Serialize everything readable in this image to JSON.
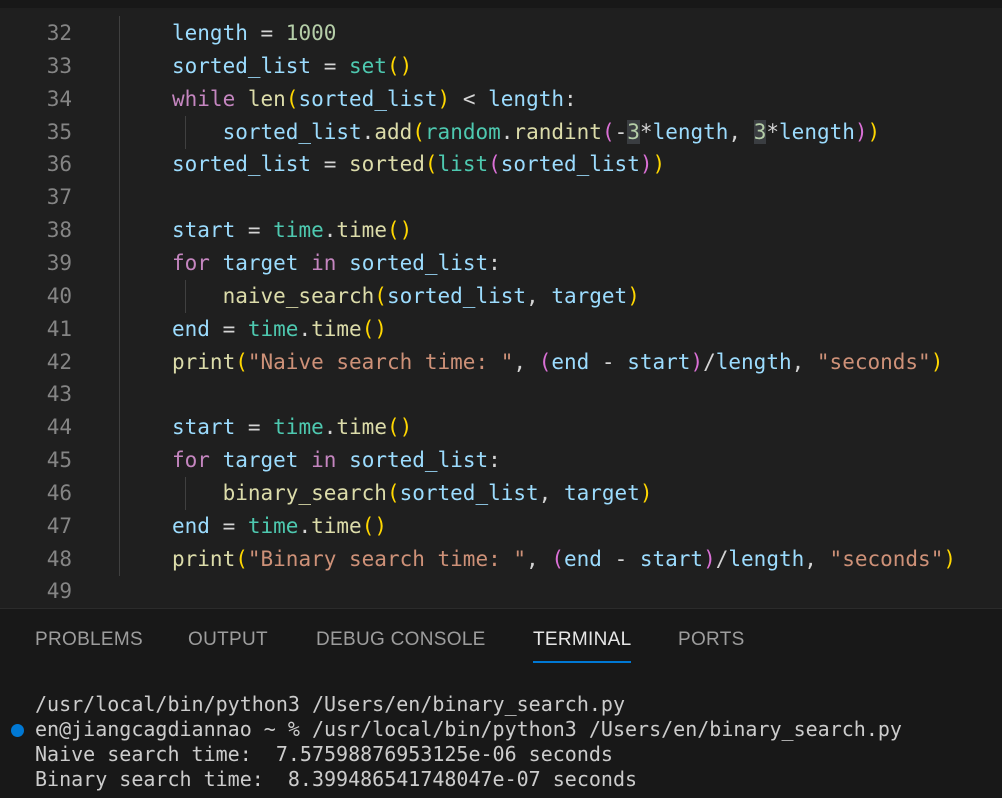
{
  "editor": {
    "lines": [
      {
        "num": "32",
        "tokens": [
          {
            "t": "length",
            "c": "t-plain"
          },
          {
            "t": " = ",
            "c": "t-op"
          },
          {
            "t": "1000",
            "c": "t-num"
          }
        ]
      },
      {
        "num": "33",
        "tokens": [
          {
            "t": "sorted_list",
            "c": "t-plain"
          },
          {
            "t": " = ",
            "c": "t-op"
          },
          {
            "t": "set",
            "c": "t-cls"
          },
          {
            "t": "()",
            "c": "t-br1"
          }
        ]
      },
      {
        "num": "34",
        "tokens": [
          {
            "t": "while",
            "c": "t-kw"
          },
          {
            "t": " ",
            "c": "t-op"
          },
          {
            "t": "len",
            "c": "t-fn"
          },
          {
            "t": "(",
            "c": "t-br1"
          },
          {
            "t": "sorted_list",
            "c": "t-plain"
          },
          {
            "t": ")",
            "c": "t-br1"
          },
          {
            "t": " < ",
            "c": "t-op"
          },
          {
            "t": "length",
            "c": "t-plain"
          },
          {
            "t": ":",
            "c": "t-op"
          }
        ]
      },
      {
        "num": "35",
        "indent": true,
        "tokens": [
          {
            "t": "    sorted_list",
            "c": "t-plain"
          },
          {
            "t": ".",
            "c": "t-op"
          },
          {
            "t": "add",
            "c": "t-fn"
          },
          {
            "t": "(",
            "c": "t-br1"
          },
          {
            "t": "random",
            "c": "t-cls"
          },
          {
            "t": ".",
            "c": "t-op"
          },
          {
            "t": "randint",
            "c": "t-fn"
          },
          {
            "t": "(",
            "c": "t-br2"
          },
          {
            "t": "-",
            "c": "t-op"
          },
          {
            "t": "3",
            "c": "t-num t-hl"
          },
          {
            "t": "*",
            "c": "t-op"
          },
          {
            "t": "length",
            "c": "t-plain"
          },
          {
            "t": ", ",
            "c": "t-op"
          },
          {
            "t": "3",
            "c": "t-num t-hl"
          },
          {
            "t": "*",
            "c": "t-op"
          },
          {
            "t": "length",
            "c": "t-plain"
          },
          {
            "t": ")",
            "c": "t-br2"
          },
          {
            "t": ")",
            "c": "t-br1"
          }
        ]
      },
      {
        "num": "36",
        "tokens": [
          {
            "t": "sorted_list",
            "c": "t-plain"
          },
          {
            "t": " = ",
            "c": "t-op"
          },
          {
            "t": "sorted",
            "c": "t-fn"
          },
          {
            "t": "(",
            "c": "t-br1"
          },
          {
            "t": "list",
            "c": "t-cls"
          },
          {
            "t": "(",
            "c": "t-br2"
          },
          {
            "t": "sorted_list",
            "c": "t-plain"
          },
          {
            "t": ")",
            "c": "t-br2"
          },
          {
            "t": ")",
            "c": "t-br1"
          }
        ]
      },
      {
        "num": "37",
        "tokens": []
      },
      {
        "num": "38",
        "tokens": [
          {
            "t": "start",
            "c": "t-plain"
          },
          {
            "t": " = ",
            "c": "t-op"
          },
          {
            "t": "time",
            "c": "t-cls"
          },
          {
            "t": ".",
            "c": "t-op"
          },
          {
            "t": "time",
            "c": "t-fn"
          },
          {
            "t": "()",
            "c": "t-br1"
          }
        ]
      },
      {
        "num": "39",
        "tokens": [
          {
            "t": "for",
            "c": "t-kw"
          },
          {
            "t": " ",
            "c": "t-op"
          },
          {
            "t": "target",
            "c": "t-plain"
          },
          {
            "t": " ",
            "c": "t-op"
          },
          {
            "t": "in",
            "c": "t-kw"
          },
          {
            "t": " ",
            "c": "t-op"
          },
          {
            "t": "sorted_list",
            "c": "t-plain"
          },
          {
            "t": ":",
            "c": "t-op"
          }
        ]
      },
      {
        "num": "40",
        "indent": true,
        "tokens": [
          {
            "t": "    naive_search",
            "c": "t-fn"
          },
          {
            "t": "(",
            "c": "t-br1"
          },
          {
            "t": "sorted_list",
            "c": "t-plain"
          },
          {
            "t": ", ",
            "c": "t-op"
          },
          {
            "t": "target",
            "c": "t-plain"
          },
          {
            "t": ")",
            "c": "t-br1"
          }
        ]
      },
      {
        "num": "41",
        "tokens": [
          {
            "t": "end",
            "c": "t-plain"
          },
          {
            "t": " = ",
            "c": "t-op"
          },
          {
            "t": "time",
            "c": "t-cls"
          },
          {
            "t": ".",
            "c": "t-op"
          },
          {
            "t": "time",
            "c": "t-fn"
          },
          {
            "t": "()",
            "c": "t-br1"
          }
        ]
      },
      {
        "num": "42",
        "tokens": [
          {
            "t": "print",
            "c": "t-fn"
          },
          {
            "t": "(",
            "c": "t-br1"
          },
          {
            "t": "\"Naive search time: \"",
            "c": "t-str"
          },
          {
            "t": ", ",
            "c": "t-op"
          },
          {
            "t": "(",
            "c": "t-br2"
          },
          {
            "t": "end",
            "c": "t-plain"
          },
          {
            "t": " - ",
            "c": "t-op"
          },
          {
            "t": "start",
            "c": "t-plain"
          },
          {
            "t": ")",
            "c": "t-br2"
          },
          {
            "t": "/",
            "c": "t-op"
          },
          {
            "t": "length",
            "c": "t-plain"
          },
          {
            "t": ", ",
            "c": "t-op"
          },
          {
            "t": "\"seconds\"",
            "c": "t-str"
          },
          {
            "t": ")",
            "c": "t-br1"
          }
        ]
      },
      {
        "num": "43",
        "tokens": []
      },
      {
        "num": "44",
        "tokens": [
          {
            "t": "start",
            "c": "t-plain"
          },
          {
            "t": " = ",
            "c": "t-op"
          },
          {
            "t": "time",
            "c": "t-cls"
          },
          {
            "t": ".",
            "c": "t-op"
          },
          {
            "t": "time",
            "c": "t-fn"
          },
          {
            "t": "()",
            "c": "t-br1"
          }
        ]
      },
      {
        "num": "45",
        "tokens": [
          {
            "t": "for",
            "c": "t-kw"
          },
          {
            "t": " ",
            "c": "t-op"
          },
          {
            "t": "target",
            "c": "t-plain"
          },
          {
            "t": " ",
            "c": "t-op"
          },
          {
            "t": "in",
            "c": "t-kw"
          },
          {
            "t": " ",
            "c": "t-op"
          },
          {
            "t": "sorted_list",
            "c": "t-plain"
          },
          {
            "t": ":",
            "c": "t-op"
          }
        ]
      },
      {
        "num": "46",
        "indent": true,
        "tokens": [
          {
            "t": "    binary_search",
            "c": "t-fn"
          },
          {
            "t": "(",
            "c": "t-br1"
          },
          {
            "t": "sorted_list",
            "c": "t-plain"
          },
          {
            "t": ", ",
            "c": "t-op"
          },
          {
            "t": "target",
            "c": "t-plain"
          },
          {
            "t": ")",
            "c": "t-br1"
          }
        ]
      },
      {
        "num": "47",
        "tokens": [
          {
            "t": "end",
            "c": "t-plain"
          },
          {
            "t": " = ",
            "c": "t-op"
          },
          {
            "t": "time",
            "c": "t-cls"
          },
          {
            "t": ".",
            "c": "t-op"
          },
          {
            "t": "time",
            "c": "t-fn"
          },
          {
            "t": "()",
            "c": "t-br1"
          }
        ]
      },
      {
        "num": "48",
        "tokens": [
          {
            "t": "print",
            "c": "t-fn"
          },
          {
            "t": "(",
            "c": "t-br1"
          },
          {
            "t": "\"Binary search time: \"",
            "c": "t-str"
          },
          {
            "t": ", ",
            "c": "t-op"
          },
          {
            "t": "(",
            "c": "t-br2"
          },
          {
            "t": "end",
            "c": "t-plain"
          },
          {
            "t": " - ",
            "c": "t-op"
          },
          {
            "t": "start",
            "c": "t-plain"
          },
          {
            "t": ")",
            "c": "t-br2"
          },
          {
            "t": "/",
            "c": "t-op"
          },
          {
            "t": "length",
            "c": "t-plain"
          },
          {
            "t": ", ",
            "c": "t-op"
          },
          {
            "t": "\"seconds\"",
            "c": "t-str"
          },
          {
            "t": ")",
            "c": "t-br1"
          }
        ]
      },
      {
        "num": "49",
        "tokens": []
      }
    ]
  },
  "panel": {
    "tabs": {
      "problems": "PROBLEMS",
      "output": "OUTPUT",
      "debug_console": "DEBUG CONSOLE",
      "terminal": "TERMINAL",
      "ports": "PORTS"
    },
    "active_tab": "TERMINAL",
    "terminal": {
      "line1": "/usr/local/bin/python3 /Users/en/binary_search.py",
      "line2": "en@jiangcagdiannao ~ % /usr/local/bin/python3 /Users/en/binary_search.py",
      "line3": "Naive search time:  7.57598876953125e-06 seconds",
      "line4": "Binary search time:  8.399486541748047e-07 seconds"
    }
  },
  "colors": {
    "accent": "#0078d4",
    "editor_bg": "#1f1f1f",
    "panel_bg": "#181818"
  }
}
